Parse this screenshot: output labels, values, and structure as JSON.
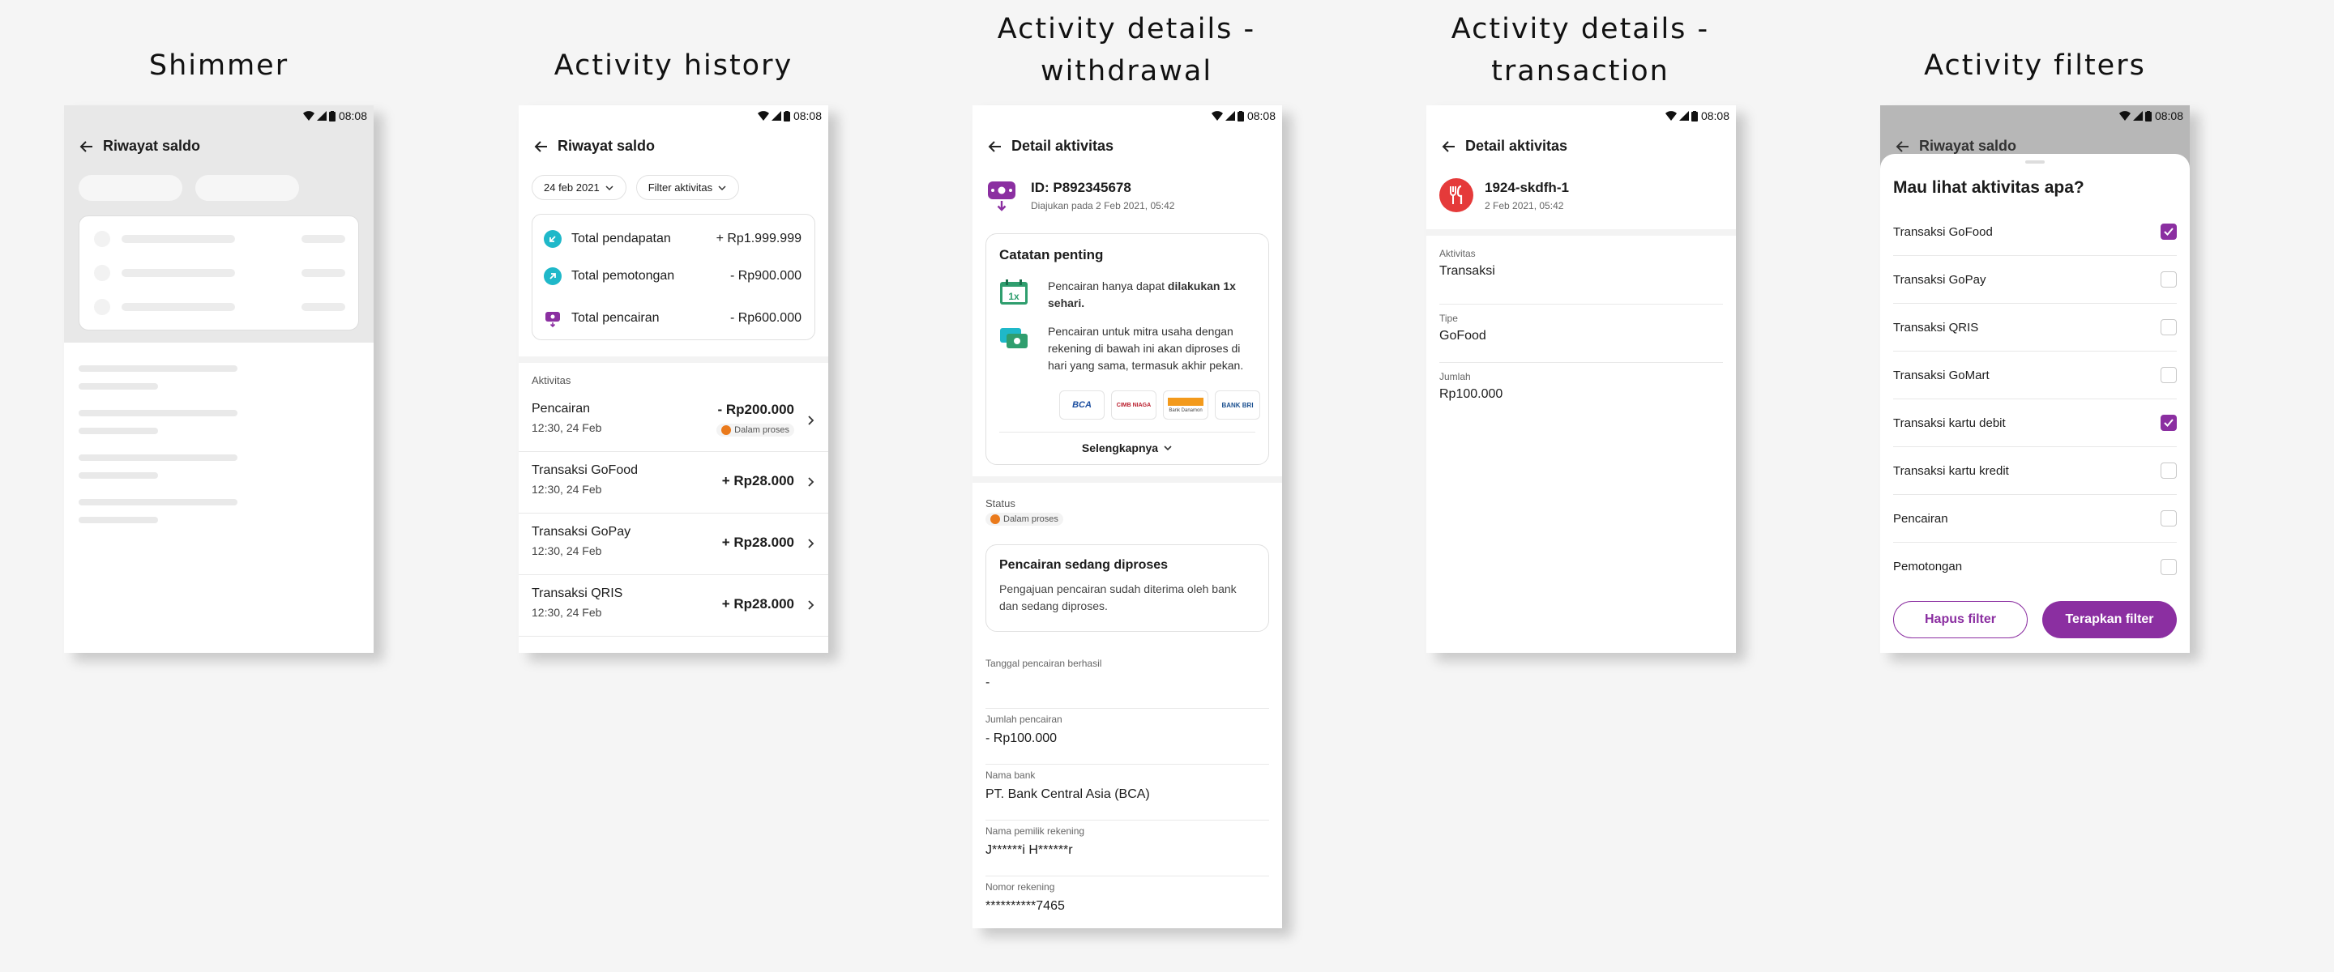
{
  "titles": {
    "shimmer": "Shimmer",
    "history": "Activity history",
    "withdrawal_line1": "Activity details -",
    "withdrawal_line2": "withdrawal",
    "transaction_line1": "Activity details -",
    "transaction_line2": "transaction",
    "filters": "Activity filters"
  },
  "status_time": "08:08",
  "shimmer": {
    "appbar_title": "Riwayat saldo"
  },
  "history": {
    "appbar_title": "Riwayat saldo",
    "date_chip": "24 feb 2021",
    "filter_chip": "Filter aktivitas",
    "summary": [
      {
        "label": "Total pendapatan",
        "value": "+ Rp1.999.999",
        "icon": "arrow-in-icon",
        "color": "#1fb8c9"
      },
      {
        "label": "Total pemotongan",
        "value": "- Rp900.000",
        "icon": "arrow-out-icon",
        "color": "#1fb8c9"
      },
      {
        "label": "Total pencairan",
        "value": "- Rp600.000",
        "icon": "wallet-icon",
        "color": "#8b2fa1"
      }
    ],
    "section_label": "Aktivitas",
    "items": [
      {
        "title": "Pencairan",
        "time": "12:30, 24 Feb",
        "amount": "- Rp200.000",
        "badge": "Dalam proses"
      },
      {
        "title": "Transaksi GoFood",
        "time": "12:30, 24 Feb",
        "amount": "+ Rp28.000"
      },
      {
        "title": "Transaksi GoPay",
        "time": "12:30, 24 Feb",
        "amount": "+ Rp28.000"
      },
      {
        "title": "Transaksi QRIS",
        "time": "12:30, 24 Feb",
        "amount": "+ Rp28.000"
      }
    ]
  },
  "withdrawal": {
    "appbar_title": "Detail aktivitas",
    "id": "ID: P892345678",
    "submitted": "Diajukan pada 2 Feb 2021, 05:42",
    "note_title": "Catatan penting",
    "note1_pre": "Pencairan hanya dapat ",
    "note1_bold": "dilakukan 1x sehari.",
    "note1_icon_text": "1x",
    "note2": "Pencairan untuk mitra usaha dengan rekening di bawah ini akan diproses di hari yang sama, termasuk akhir pekan.",
    "banks": [
      "BCA",
      "CIMB NIAGA",
      "Bank Danamon",
      "BANK BRI"
    ],
    "more": "Selengkapnya",
    "status_label": "Status",
    "status_badge": "Dalam proses",
    "process_title": "Pencairan sedang diproses",
    "process_desc": "Pengajuan pencairan sudah diterima oleh bank dan sedang diproses.",
    "fields": [
      {
        "label": "Tanggal pencairan berhasil",
        "value": "-"
      },
      {
        "label": "Jumlah pencairan",
        "value": "- Rp100.000"
      },
      {
        "label": "Nama bank",
        "value": "PT. Bank Central Asia (BCA)"
      },
      {
        "label": "Nama pemilik rekening",
        "value": "J******i H******r"
      },
      {
        "label": "Nomor rekening",
        "value": "**********7465"
      }
    ]
  },
  "transaction": {
    "appbar_title": "Detail aktivitas",
    "id": "1924-skdfh-1",
    "date": "2 Feb 2021, 05:42",
    "fields": [
      {
        "label": "Aktivitas",
        "value": "Transaksi"
      },
      {
        "label": "Tipe",
        "value": "GoFood"
      },
      {
        "label": "Jumlah",
        "value": "Rp100.000"
      }
    ]
  },
  "filters": {
    "appbar_title": "Riwayat saldo",
    "sheet_title": "Mau lihat aktivitas apa?",
    "options": [
      {
        "label": "Transaksi GoFood",
        "checked": true
      },
      {
        "label": "Transaksi GoPay",
        "checked": false
      },
      {
        "label": "Transaksi QRIS",
        "checked": false
      },
      {
        "label": "Transaksi GoMart",
        "checked": false
      },
      {
        "label": "Transaksi kartu debit",
        "checked": true
      },
      {
        "label": "Transaksi kartu kredit",
        "checked": false
      },
      {
        "label": "Pencairan",
        "checked": false
      },
      {
        "label": "Pemotongan",
        "checked": false
      }
    ],
    "clear_button": "Hapus filter",
    "apply_button": "Terapkan filter"
  },
  "colors": {
    "purple": "#8b2fa1",
    "teal": "#1fb8c9",
    "orange": "#ea7a1c",
    "red": "#e53a3a"
  }
}
